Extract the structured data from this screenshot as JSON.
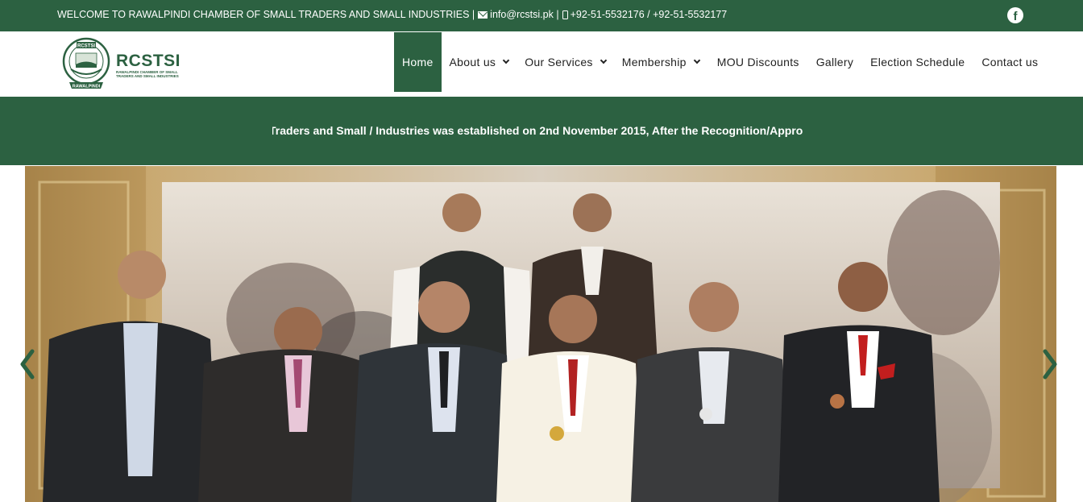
{
  "topbar": {
    "welcome": "WELCOME TO RAWALPINDI CHAMBER OF SMALL TRADERS AND SMALL INDUSTRIES |",
    "email": "info@rcstsi.pk |",
    "phones": "+92-51-5532176 / +92-51-5532177",
    "social_icon": "facebook-icon"
  },
  "header": {
    "logo_text": "RCSTSI",
    "logo_subtext": "RAWALPINDI CHAMBER OF SMALL TRADERS AND SMALL INDUSTRIES",
    "seal_top_text": "RCSTSI",
    "seal_bottom_text": "RAWALPINDI"
  },
  "nav": {
    "items": [
      {
        "label": "Home"
      },
      {
        "label": "About us"
      },
      {
        "label": "Our Services"
      },
      {
        "label": "Membership"
      },
      {
        "label": "MOU Discounts"
      },
      {
        "label": "Gallery"
      },
      {
        "label": "Election Schedule"
      },
      {
        "label": "Contact us"
      }
    ]
  },
  "ticker": {
    "text": "Traders and Small / Industries was established on 2nd November 2015, After the Recognition/Approval of D"
  },
  "colors": {
    "brand_green": "#2c6141",
    "white": "#ffffff"
  }
}
